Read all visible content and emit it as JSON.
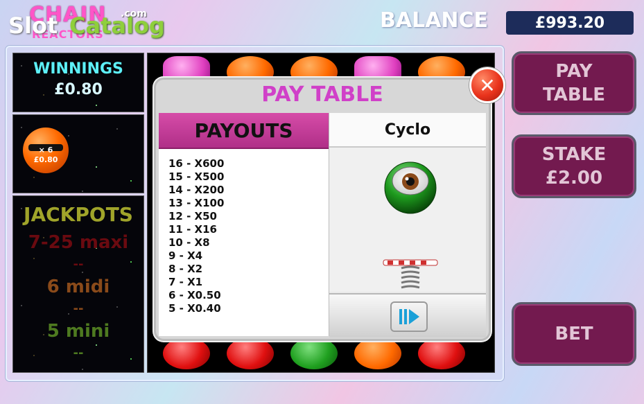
{
  "logo": {
    "line1": "CHAIN",
    "line2": "REACTORS",
    "watermark_slot": "Slot",
    "watermark_catalog": "Catalog",
    "watermark_com": ".com"
  },
  "header": {
    "balance_label": "BALANCE",
    "balance_value": "£993.20"
  },
  "winnings": {
    "label": "WINNINGS",
    "value": "£0.80"
  },
  "multiplier": {
    "mult": "× 6",
    "value": "£0.80"
  },
  "jackpots": {
    "title": "JACKPOTS",
    "levels": [
      {
        "label": "7-25 maxi",
        "value": "--",
        "color": "#6a0a10"
      },
      {
        "label": "6 midi",
        "value": "--",
        "color": "#8a4a1a"
      },
      {
        "label": "5 mini",
        "value": "--",
        "color": "#4e7a20"
      }
    ]
  },
  "buttons": {
    "pay_table_line1": "PAY",
    "pay_table_line2": "TABLE",
    "stake_line1": "STAKE",
    "stake_line2": "£2.00",
    "bet": "BET"
  },
  "pay_table": {
    "title": "PAY TABLE",
    "close_glyph": "✕",
    "payouts_header": "PAYOUTS",
    "symbol_name": "Cyclo",
    "payouts": [
      "16 - X600",
      "15 - X500",
      "14 - X200",
      "13 - X100",
      "12 - X50",
      "11 - X16",
      "10 - X8",
      "9 - X4",
      "8 - X2",
      "7 - X1",
      "6 - X0.50",
      "5 - X0.40"
    ],
    "next_icon": "next-arrow-icon"
  },
  "colors": {
    "accent_pink": "#d040c8",
    "button_purple": "#731a4f",
    "balance_bg": "#1d2c5a",
    "winnings_cyan": "#5df0f8"
  }
}
